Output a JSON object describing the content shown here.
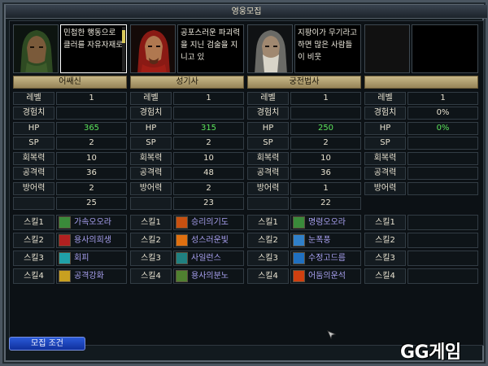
{
  "window": {
    "title": "영웅모집"
  },
  "row_labels": {
    "level": "레벨",
    "exp": "경험치",
    "hp": "HP",
    "sp": "SP",
    "recovery": "회복력",
    "attack": "공격력",
    "defense": "방어력"
  },
  "heroes": [
    {
      "class_name": "어쌔신",
      "description": "민첩한 행동으로 클러를 자유자재로",
      "portrait": "hooded-assassin",
      "stats": {
        "level": "1",
        "exp": "",
        "hp": "365",
        "sp": "2",
        "recovery": "10",
        "attack": "36",
        "defense": "2",
        "extra": "25"
      },
      "skills": [
        {
          "label": "스킬1",
          "name": "가속오오라",
          "icon": "aura-icon",
          "color": "#3a8a3a"
        },
        {
          "label": "스킬2",
          "name": "용사의희생",
          "icon": "sacrifice-icon",
          "color": "#b02020"
        },
        {
          "label": "스킬3",
          "name": "회피",
          "icon": "evade-icon",
          "color": "#20a0a8"
        },
        {
          "label": "스킬4",
          "name": "공격강화",
          "icon": "attack-boost-icon",
          "color": "#c8a020"
        }
      ]
    },
    {
      "class_name": "성기사",
      "description": "공포스러운 파괴력을 지닌 검술을 지니고 있",
      "portrait": "red-knight",
      "stats": {
        "level": "1",
        "exp": "",
        "hp": "315",
        "sp": "2",
        "recovery": "10",
        "attack": "48",
        "defense": "2",
        "extra": "23"
      },
      "skills": [
        {
          "label": "스킬1",
          "name": "승리의기도",
          "icon": "prayer-icon",
          "color": "#c85010"
        },
        {
          "label": "스킬2",
          "name": "성스러운빛",
          "icon": "holy-light-icon",
          "color": "#e07010"
        },
        {
          "label": "스킬3",
          "name": "사일런스",
          "icon": "silence-icon",
          "color": "#208080"
        },
        {
          "label": "스킬4",
          "name": "용사의분노",
          "icon": "rage-icon",
          "color": "#508030"
        }
      ]
    },
    {
      "class_name": "궁전법사",
      "description": "지팡이가 무기라고 하면 많은 사람들이 비웃",
      "portrait": "old-wizard",
      "stats": {
        "level": "1",
        "exp": "",
        "hp": "250",
        "sp": "2",
        "recovery": "10",
        "attack": "36",
        "defense": "1",
        "extra": "22"
      },
      "skills": [
        {
          "label": "스킬1",
          "name": "명령오오라",
          "icon": "command-aura-icon",
          "color": "#3a8a3a"
        },
        {
          "label": "스킬2",
          "name": "눈폭풍",
          "icon": "blizzard-icon",
          "color": "#3080c8"
        },
        {
          "label": "스킬3",
          "name": "수정고드름",
          "icon": "icicle-icon",
          "color": "#2070c0"
        },
        {
          "label": "스킬4",
          "name": "어둠의운석",
          "icon": "meteor-icon",
          "color": "#d04010"
        }
      ]
    },
    {
      "class_name": "",
      "description": "",
      "portrait": "empty",
      "stats": {
        "level": "1",
        "exp": "0%",
        "hp": "0%",
        "sp": "",
        "recovery": "",
        "attack": "",
        "defense": "",
        "extra": ""
      },
      "skills": [
        {
          "label": "스킬1",
          "name": "",
          "icon": "",
          "color": ""
        },
        {
          "label": "스킬2",
          "name": "",
          "icon": "",
          "color": ""
        },
        {
          "label": "스킬3",
          "name": "",
          "icon": "",
          "color": ""
        },
        {
          "label": "스킬4",
          "name": "",
          "icon": "",
          "color": ""
        }
      ]
    }
  ],
  "footer": {
    "recruit_condition_label": "모집 조건"
  },
  "watermark": "GG게임"
}
